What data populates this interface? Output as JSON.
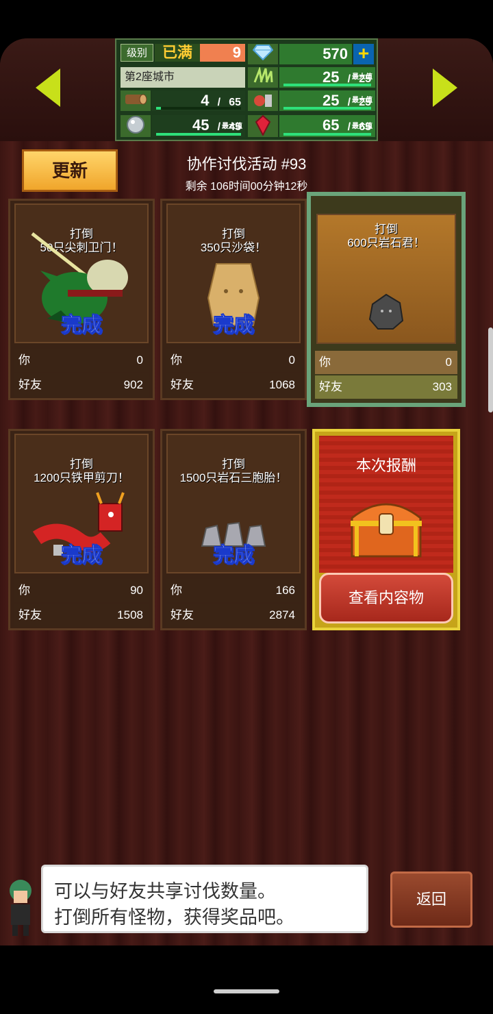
{
  "header": {
    "level_label": "级别",
    "level_max_text": "已满",
    "level_value": "9",
    "gems": "570",
    "city_label": "第2座城市",
    "wood": {
      "current": "4",
      "max": "65",
      "bar_fraction": 0.06
    },
    "grass": {
      "current": "25",
      "max": "25",
      "max_tag": "最大值",
      "bar_fraction": 1.0
    },
    "food": {
      "current": "25",
      "max": "25",
      "max_tag": "最大值",
      "bar_fraction": 1.0
    },
    "stone": {
      "current": "45",
      "max": "45",
      "max_tag": "最大值",
      "bar_fraction": 1.0
    },
    "ruby": {
      "current": "65",
      "max": "65",
      "max_tag": "最大值",
      "bar_fraction": 1.0
    },
    "slash": "/",
    "plus": "+"
  },
  "toolbar": {
    "update_label": "更新"
  },
  "event": {
    "title": "协作讨伐活动 #93",
    "remaining": "剩余 106时间00分钟12秒"
  },
  "cards": [
    {
      "line1": "打倒",
      "line2": "50只尖刺卫门！",
      "done": "完成",
      "you_label": "你",
      "you_value": "0",
      "friend_label": "好友",
      "friend_value": "902",
      "monster": "spike-guard-icon"
    },
    {
      "line1": "打倒",
      "line2": "350只沙袋！",
      "done": "完成",
      "you_label": "你",
      "you_value": "0",
      "friend_label": "好友",
      "friend_value": "1068",
      "monster": "sandbag-icon"
    },
    {
      "line1": "打倒",
      "line2": "600只岩石君！",
      "done": "",
      "you_label": "你",
      "you_value": "0",
      "friend_label": "好友",
      "friend_value": "303",
      "monster": "rock-golem-icon"
    },
    {
      "line1": "打倒",
      "line2": "1200只铁甲剪刀！",
      "done": "完成",
      "you_label": "你",
      "you_value": "90",
      "friend_label": "好友",
      "friend_value": "1508",
      "monster": "iron-scissor-icon"
    },
    {
      "line1": "打倒",
      "line2": "1500只岩石三胞胎！",
      "done": "完成",
      "you_label": "你",
      "you_value": "166",
      "friend_label": "好友",
      "friend_value": "2874",
      "monster": "rock-triplets-icon"
    }
  ],
  "reward": {
    "title": "本次报酬",
    "button": "查看内容物"
  },
  "hint": {
    "line1": "可以与好友共享讨伐数量。",
    "line2": "打倒所有怪物，获得奖品吧。"
  },
  "footer": {
    "back_label": "返回"
  }
}
